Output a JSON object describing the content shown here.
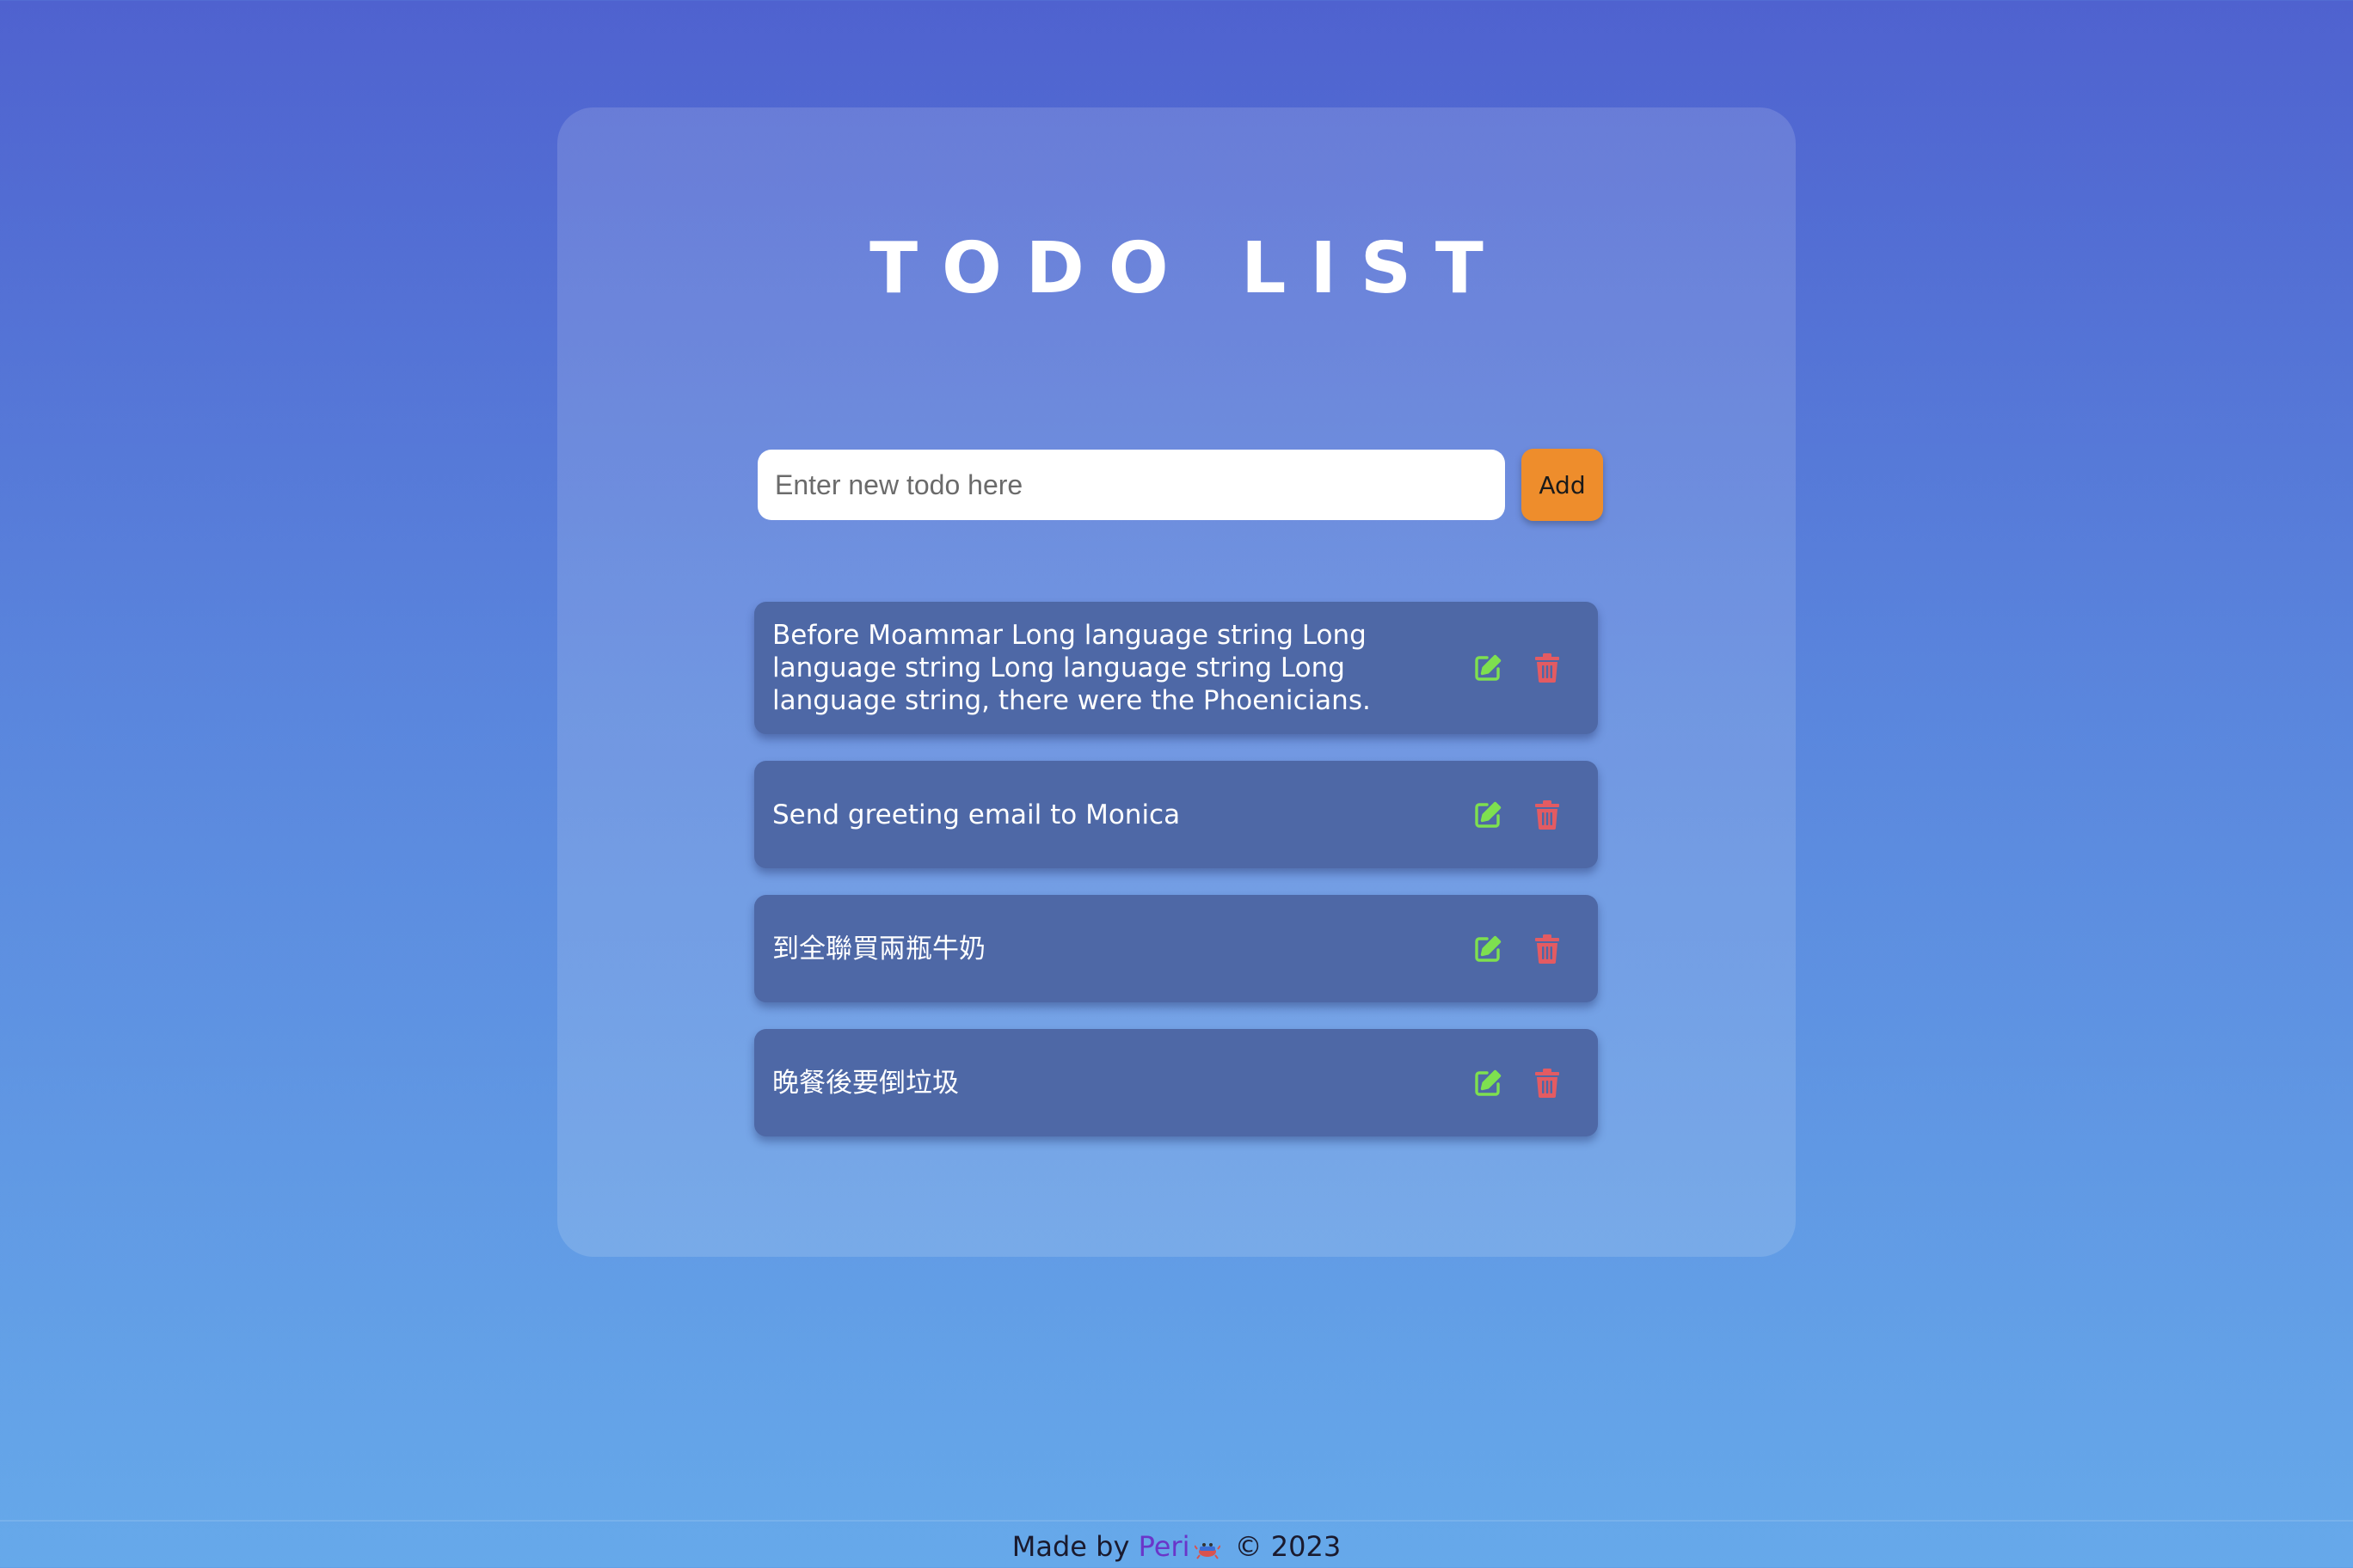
{
  "app": {
    "title": "TODO LIST"
  },
  "new_todo": {
    "placeholder": "Enter new todo here",
    "value": "",
    "add_label": "Add"
  },
  "todos": [
    {
      "text": "Before Moammar Long language string Long language string Long language string Long language string, there were the Phoenicians."
    },
    {
      "text": "Send greeting email to Monica"
    },
    {
      "text": "到全聯買兩瓶牛奶"
    },
    {
      "text": "晚餐後要倒垃圾"
    }
  ],
  "icons": {
    "edit": "edit-icon",
    "delete": "trash-icon",
    "footer": "crab-icon"
  },
  "colors": {
    "edit_icon": "#7ee04f",
    "delete_icon": "#e35b62",
    "add_button": "#ee8d2c",
    "author_link": "#6a36c9"
  },
  "footer": {
    "prefix": "Made by",
    "author": "Peri",
    "copyright": "© 2023"
  }
}
